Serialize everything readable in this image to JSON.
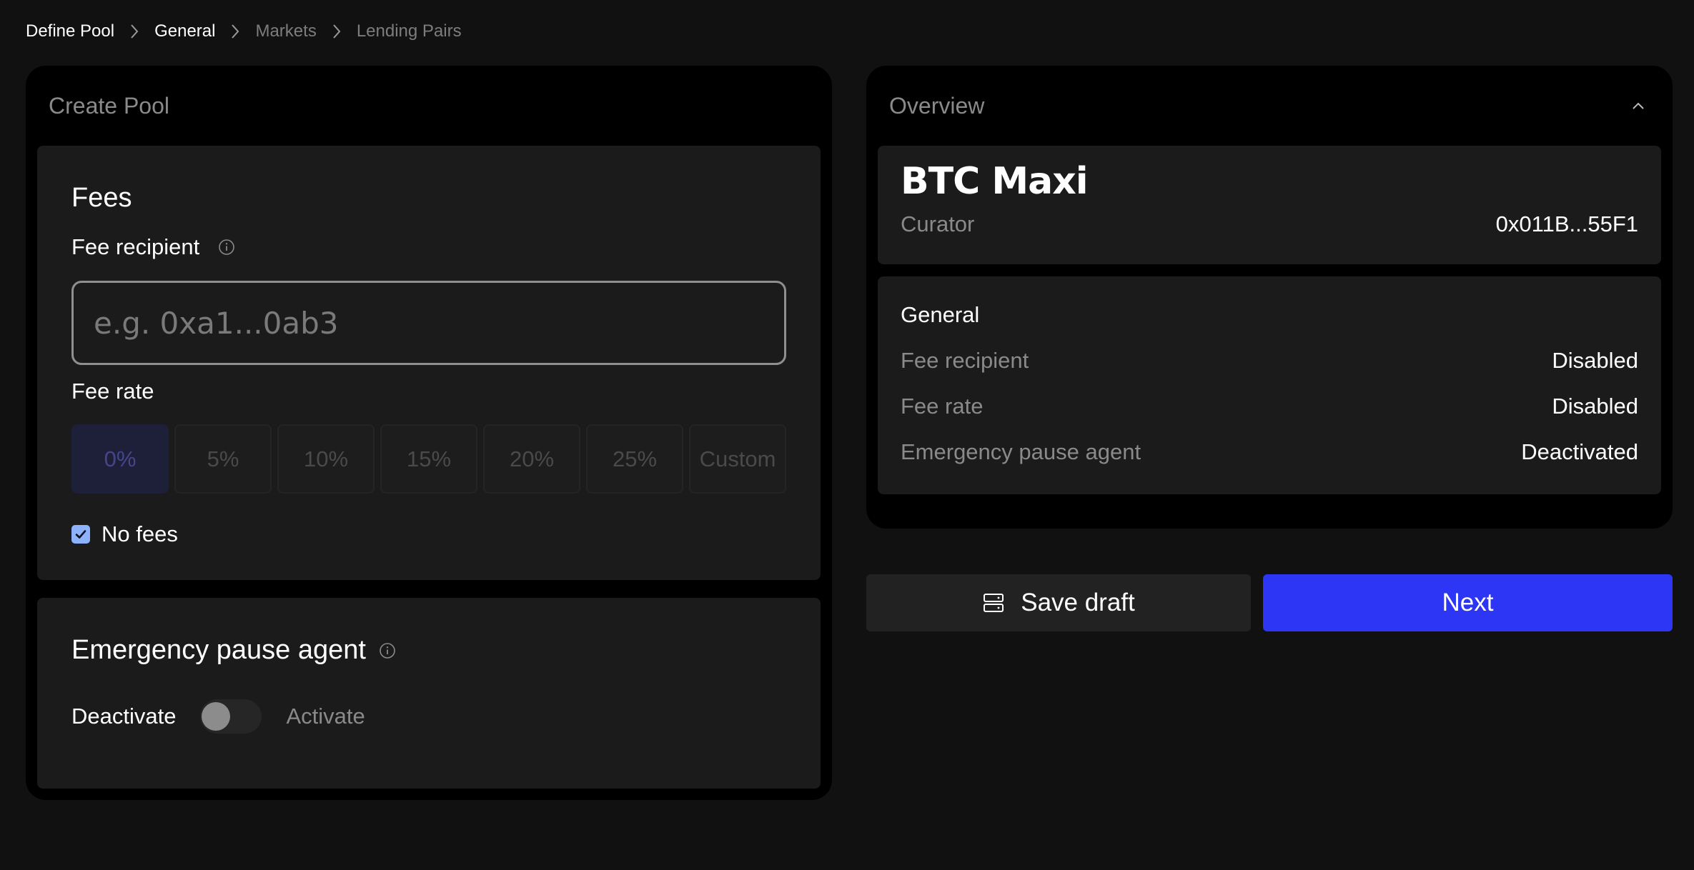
{
  "breadcrumb": {
    "items": [
      {
        "label": "Define Pool",
        "state": "done"
      },
      {
        "label": "General",
        "state": "current"
      },
      {
        "label": "Markets",
        "state": "future"
      },
      {
        "label": "Lending Pairs",
        "state": "future"
      }
    ]
  },
  "create_pool": {
    "title": "Create Pool",
    "fees": {
      "heading": "Fees",
      "fee_recipient_label": "Fee recipient",
      "fee_recipient_placeholder": "e.g. 0xa1...0ab3",
      "fee_recipient_value": "",
      "fee_rate_label": "Fee rate",
      "rate_options": [
        "0%",
        "5%",
        "10%",
        "15%",
        "20%",
        "25%",
        "Custom"
      ],
      "selected_rate": "0%",
      "no_fees_label": "No fees",
      "no_fees_checked": true
    },
    "emergency": {
      "heading": "Emergency pause agent",
      "deactivate_label": "Deactivate",
      "activate_label": "Activate",
      "active": false
    }
  },
  "overview": {
    "title": "Overview",
    "pool_name": "BTC Maxi",
    "curator_label": "Curator",
    "curator_value": "0x011B...55F1",
    "general_title": "General",
    "rows": [
      {
        "label": "Fee recipient",
        "value": "Disabled"
      },
      {
        "label": "Fee rate",
        "value": "Disabled"
      },
      {
        "label": "Emergency pause agent",
        "value": "Deactivated"
      }
    ]
  },
  "actions": {
    "save_draft_label": "Save draft",
    "next_label": "Next"
  },
  "colors": {
    "background": "#111111",
    "panel": "#000000",
    "card": "#1b1b1b",
    "accent": "#2e36f5",
    "checkbox": "#8db3ff"
  }
}
